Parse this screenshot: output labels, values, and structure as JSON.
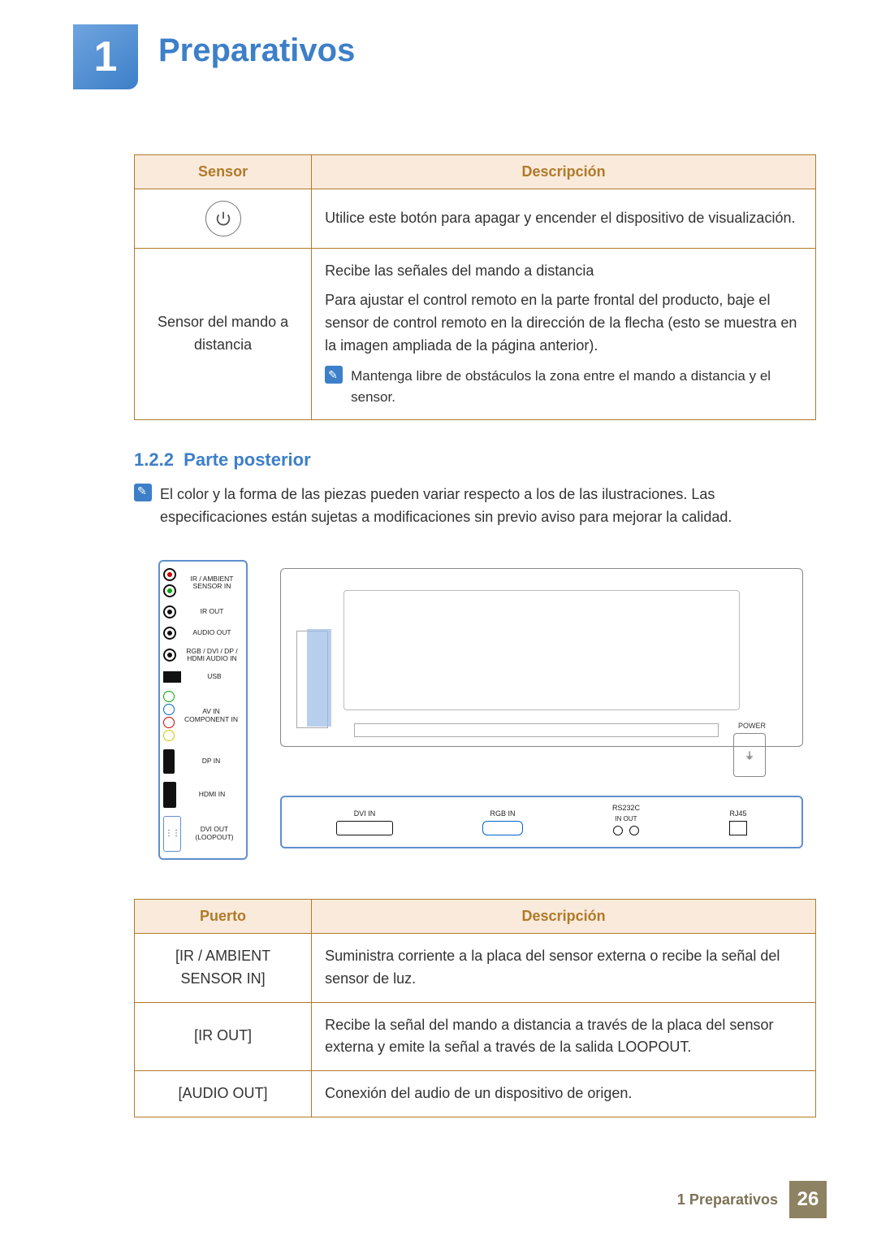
{
  "chapter": {
    "number": "1",
    "title": "Preparativos"
  },
  "table1": {
    "headers": {
      "col1": "Sensor",
      "col2": "Descripción"
    },
    "row1": {
      "sensor_is_icon": true,
      "desc": "Utilice este botón para apagar y encender el dispositivo de visualización."
    },
    "row2": {
      "sensor": "Sensor del mando a distancia",
      "desc_l1": "Recibe las señales del mando a distancia",
      "desc_l2": "Para ajustar el control remoto en la parte frontal del producto, baje el sensor de control remoto en la dirección de la flecha (esto se muestra en la imagen ampliada de la página anterior).",
      "note": "Mantenga libre de obstáculos la zona entre el mando a distancia y el sensor."
    }
  },
  "section": {
    "number": "1.2.2",
    "title": "Parte posterior"
  },
  "intro_note": "El color y la forma de las piezas pueden variar respecto a los de las ilustraciones. Las especificaciones están sujetas a modificaciones sin previo aviso para mejorar la calidad.",
  "diagram": {
    "ports_vertical": {
      "ir_ambient": "IR / AMBIENT SENSOR IN",
      "ir_out": "IR OUT",
      "audio_out": "AUDIO OUT",
      "audio_in": "RGB / DVI / DP / HDMI AUDIO IN",
      "usb": "USB",
      "avin_line1": "AV IN",
      "avin_line2": "COMPONENT IN",
      "dp_in": "DP IN",
      "hdmi_in": "HDMI IN",
      "dvi_out": "DVI OUT (LOOPOUT)"
    },
    "ports_horizontal": {
      "dvi_in": "DVI IN",
      "rgb_in": "RGB IN",
      "rs232c": "RS232C",
      "rs232c_sub": "IN   OUT",
      "rj45": "RJ45"
    },
    "power_label": "POWER"
  },
  "table2": {
    "headers": {
      "col1": "Puerto",
      "col2": "Descripción"
    },
    "rows": [
      {
        "port": "[IR / AMBIENT SENSOR IN]",
        "desc": "Suministra corriente a la placa del sensor externa o recibe la señal del sensor de luz."
      },
      {
        "port": "[IR OUT]",
        "desc": "Recibe la señal del mando a distancia a través de la placa del sensor externa y emite la señal a través de la salida LOOPOUT."
      },
      {
        "port": "[AUDIO OUT]",
        "desc": "Conexión del audio de un dispositivo de origen."
      }
    ]
  },
  "footer": {
    "text": "1 Preparativos",
    "page": "26"
  }
}
